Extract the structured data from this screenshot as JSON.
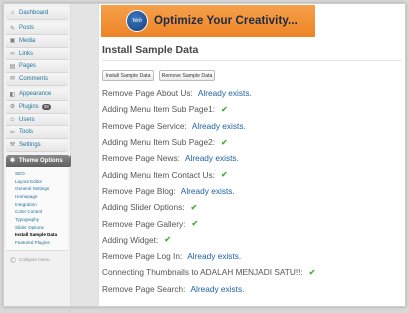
{
  "sidebar": {
    "group1": [
      {
        "label": "Dashboard",
        "icon": "dashboard-icon",
        "glyph": "⌂"
      }
    ],
    "group2": [
      {
        "label": "Posts",
        "icon": "posts-icon",
        "glyph": "✎"
      },
      {
        "label": "Media",
        "icon": "media-icon",
        "glyph": "▣"
      },
      {
        "label": "Links",
        "icon": "links-icon",
        "glyph": "∞"
      },
      {
        "label": "Pages",
        "icon": "pages-icon",
        "glyph": "▤"
      },
      {
        "label": "Comments",
        "icon": "comments-icon",
        "glyph": "✉"
      }
    ],
    "group3": [
      {
        "label": "Appearance",
        "icon": "appearance-icon",
        "glyph": "◧"
      },
      {
        "label": "Plugins",
        "icon": "plugins-icon",
        "glyph": "⚙",
        "badge": "28"
      },
      {
        "label": "Users",
        "icon": "users-icon",
        "glyph": "☺"
      },
      {
        "label": "Tools",
        "icon": "tools-icon",
        "glyph": "✂"
      },
      {
        "label": "Settings",
        "icon": "settings-icon",
        "glyph": "⚒"
      }
    ],
    "active": {
      "label": "Theme Options",
      "icon": "theme-options-icon",
      "glyph": "✱"
    },
    "submenu": [
      "SEO",
      "Layout Editor",
      "General Settings",
      "Homepage",
      "Integration",
      "Color Control",
      "Typography",
      "Slider Options",
      "Install Sample Data",
      "Featured Plugins"
    ],
    "submenu_current_index": 8,
    "collapse_label": "Collapse menu"
  },
  "banner": {
    "logo_text": "Web",
    "tagline": "Optimize Your Creativity...",
    "color": "#ee8426"
  },
  "page": {
    "title": "Install Sample Data",
    "buttons": [
      "Install Sample Data",
      "Remove Sample Data"
    ]
  },
  "log": [
    {
      "text": "Remove Page About Us:",
      "status": "Already exists.",
      "check": false
    },
    {
      "text": "Adding Menu Item Sub Page1:",
      "status": "",
      "check": true
    },
    {
      "text": "Remove Page Service:",
      "status": "Already exists.",
      "check": false
    },
    {
      "text": "Adding Menu Item Sub Page2:",
      "status": "",
      "check": true
    },
    {
      "text": "Remove Page News:",
      "status": "Already exists.",
      "check": false
    },
    {
      "text": "Adding Menu Item Contact Us:",
      "status": "",
      "check": true
    },
    {
      "text": "Remove Page Blog:",
      "status": "Already exists.",
      "check": false
    },
    {
      "text": "Adding Slider Options:",
      "status": "",
      "check": true
    },
    {
      "text": "Remove Page Gallery:",
      "status": "",
      "check": true
    },
    {
      "text": "Adding Widget:",
      "status": "",
      "check": true
    },
    {
      "text": "Remove Page Log In:",
      "status": "Already exists.",
      "check": false
    },
    {
      "text": "Connecting Thumbnails to ADALAH MENJADI SATU!!:",
      "status": "",
      "check": true
    },
    {
      "text": "Remove Page Search:",
      "status": "Already exists.",
      "check": false
    }
  ],
  "colors": {
    "link": "#21759b",
    "status": "#2161a5",
    "check": "#4cae3f"
  }
}
